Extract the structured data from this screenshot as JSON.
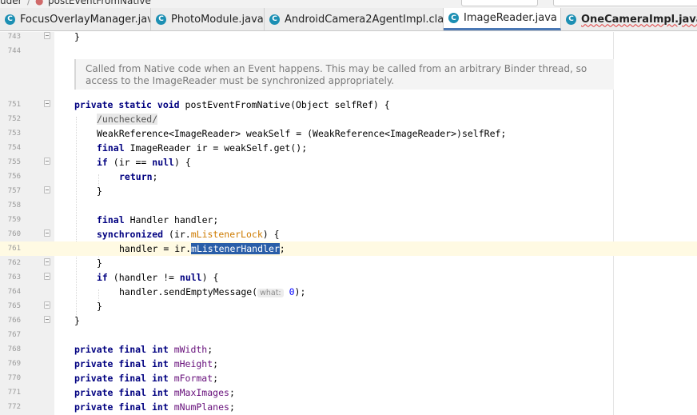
{
  "breadcrumb": {
    "first": "uder",
    "last": "postEventFromNative"
  },
  "tabs": [
    {
      "label": "FocusOverlayManager.java",
      "active": false,
      "error": false
    },
    {
      "label": "PhotoModule.java",
      "active": false,
      "error": false
    },
    {
      "label": "AndroidCamera2AgentImpl.class",
      "active": false,
      "error": false
    },
    {
      "label": "ImageReader.java",
      "active": true,
      "error": false
    },
    {
      "label": "OneCameraImpl.java",
      "active": false,
      "error": true
    }
  ],
  "close_glyph": "×",
  "class_icon_letter": "C",
  "javadoc": "Called from Native code when an Event happens. This may be called from an arbitrary Binder thread, so access to the ImageReader must be synchronized appropriately.",
  "line_numbers": {
    "l743": "743",
    "l744": "744",
    "l751": "751",
    "l752": "752",
    "l753": "753",
    "l754": "754",
    "l755": "755",
    "l756": "756",
    "l757": "757",
    "l758": "758",
    "l759": "759",
    "l760": "760",
    "l761": "761",
    "l762": "762",
    "l763": "763",
    "l764": "764",
    "l765": "765",
    "l766": "766",
    "l767": "767",
    "l768": "768",
    "l769": "769",
    "l770": "770",
    "l771": "771",
    "l772": "772"
  },
  "code": {
    "brace_close": "}",
    "brace_open": "{",
    "private": "private",
    "static": "static",
    "void": "void",
    "final": "final",
    "int": "int",
    "if": "if",
    "null": "null",
    "return": "return",
    "synchronized": "synchronized",
    "method_sig": "postEventFromNative(Object selfRef) {",
    "annotation": "/unchecked/",
    "weakref_line": "WeakReference<ImageReader> weakSelf = (WeakReference<ImageReader>)selfRef;",
    "ir_decl": "ImageReader ir = weakSelf.get();",
    "if_ir_open": "(ir == ",
    "paren_brace": ") {",
    "return_semi": ";",
    "handler_decl": "Handler handler;",
    "sync_open": "(ir.",
    "listener_lock": "mListenerLock",
    "handler_assign": "handler = ir.",
    "listener_handler": "mListenerHandler",
    "if_handler_open": "(handler != ",
    "send_call": "handler.sendEmptyMessage(",
    "hint_what": "what:",
    "zero": "0",
    "call_close": ");",
    "fields": [
      "mWidth",
      "mHeight",
      "mFormat",
      "mMaxImages",
      "mNumPlanes"
    ]
  },
  "colors": {
    "keyword": "#000080",
    "field": "#660e7a",
    "field_warning": "#ce7b00",
    "selection": "#2a5ea8",
    "current_line": "#fffae3",
    "class_icon": "#1c8fb3",
    "active_tab_underline": "#4a78b5"
  }
}
